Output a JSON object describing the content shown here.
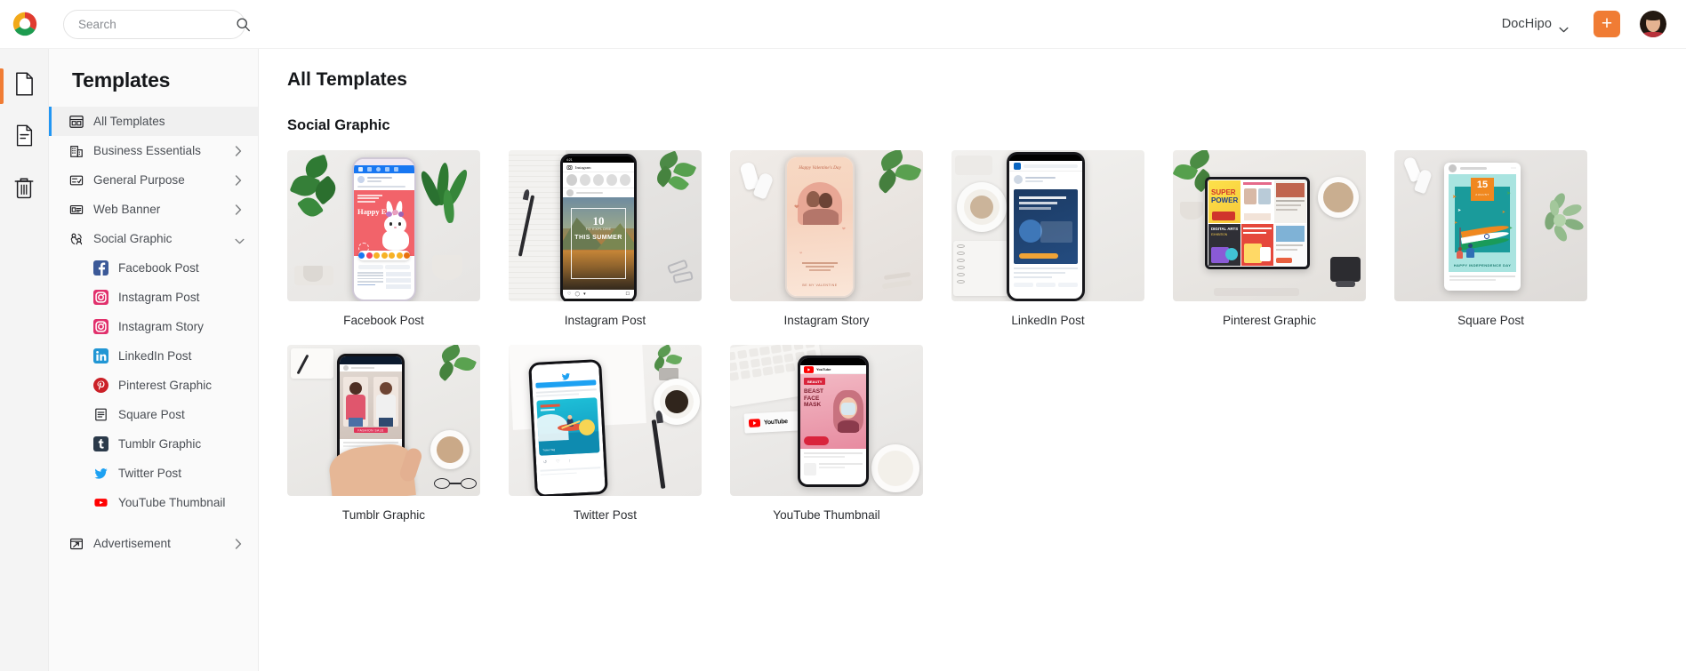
{
  "header": {
    "logo_name": "dochipo-logo",
    "search": {
      "placeholder": "Search",
      "value": "",
      "icon": "search-icon"
    },
    "brand": {
      "label": "DocHipo",
      "chevron_icon": "chevron-down-icon"
    },
    "create_button": {
      "label": "+",
      "icon": "plus-icon",
      "color": "#f07c34"
    },
    "avatar": {
      "name": "user-avatar"
    }
  },
  "rail": {
    "items": [
      {
        "name": "documents",
        "icon": "blank-document-icon",
        "active": true
      },
      {
        "name": "templates",
        "icon": "lined-document-icon",
        "active": false
      },
      {
        "name": "trash",
        "icon": "trash-icon",
        "active": false
      }
    ]
  },
  "sidebar": {
    "title": "Templates",
    "items": [
      {
        "label": "All Templates",
        "icon": "grid-layout-icon",
        "active": true,
        "expandable": false
      },
      {
        "label": "Business Essentials",
        "icon": "building-icon",
        "active": false,
        "expandable": true,
        "chevron": "chevron-right-icon"
      },
      {
        "label": "General Purpose",
        "icon": "checklist-icon",
        "active": false,
        "expandable": true,
        "chevron": "chevron-right-icon"
      },
      {
        "label": "Web Banner",
        "icon": "banner-icon",
        "active": false,
        "expandable": true,
        "chevron": "chevron-right-icon"
      },
      {
        "label": "Social Graphic",
        "icon": "people-icon",
        "active": false,
        "expandable": true,
        "expanded": true,
        "chevron": "chevron-down-icon"
      }
    ],
    "social_children": [
      {
        "label": "Facebook Post",
        "icon": "facebook-icon",
        "color": "#3b5998"
      },
      {
        "label": "Instagram Post",
        "icon": "instagram-icon",
        "color": "#e1306c"
      },
      {
        "label": "Instagram Story",
        "icon": "instagram-icon",
        "color": "#e1306c"
      },
      {
        "label": "LinkedIn Post",
        "icon": "linkedin-icon",
        "color": "#0a66c2"
      },
      {
        "label": "Pinterest Graphic",
        "icon": "pinterest-icon",
        "color": "#cb2027"
      },
      {
        "label": "Square Post",
        "icon": "square-post-icon",
        "color": "#333333"
      },
      {
        "label": "Tumblr Graphic",
        "icon": "tumblr-icon",
        "color": "#2c3d4f"
      },
      {
        "label": "Twitter Post",
        "icon": "twitter-icon",
        "color": "#1da1f2"
      },
      {
        "label": "YouTube Thumbnail",
        "icon": "youtube-icon",
        "color": "#ff0000"
      }
    ],
    "trailing_items": [
      {
        "label": "Advertisement",
        "icon": "advertisement-icon",
        "expandable": true,
        "chevron": "chevron-right-icon"
      }
    ]
  },
  "main": {
    "page_title": "All Templates",
    "sections": [
      {
        "title": "Social Graphic",
        "cards": [
          {
            "label": "Facebook Post",
            "scene": "facebook",
            "inner_text": "Happy Easter"
          },
          {
            "label": "Instagram Post",
            "scene": "instagram",
            "inner_text": "10 TO EXPLORE THIS SUMMER"
          },
          {
            "label": "Instagram Story",
            "scene": "igstory",
            "inner_text": "Happy Valentine's Day"
          },
          {
            "label": "LinkedIn Post",
            "scene": "linkedin",
            "inner_text": ""
          },
          {
            "label": "Pinterest Graphic",
            "scene": "pinterest",
            "inner_text": "SUPER POWER"
          },
          {
            "label": "Square Post",
            "scene": "square",
            "inner_text": "15 AUGUST HAPPY INDEPENDENCE DAY"
          },
          {
            "label": "Tumblr Graphic",
            "scene": "tumblr",
            "inner_text": ""
          },
          {
            "label": "Twitter Post",
            "scene": "twitter",
            "inner_text": ""
          },
          {
            "label": "YouTube Thumbnail",
            "scene": "youtube",
            "inner_text": "YouTube"
          }
        ]
      }
    ]
  }
}
